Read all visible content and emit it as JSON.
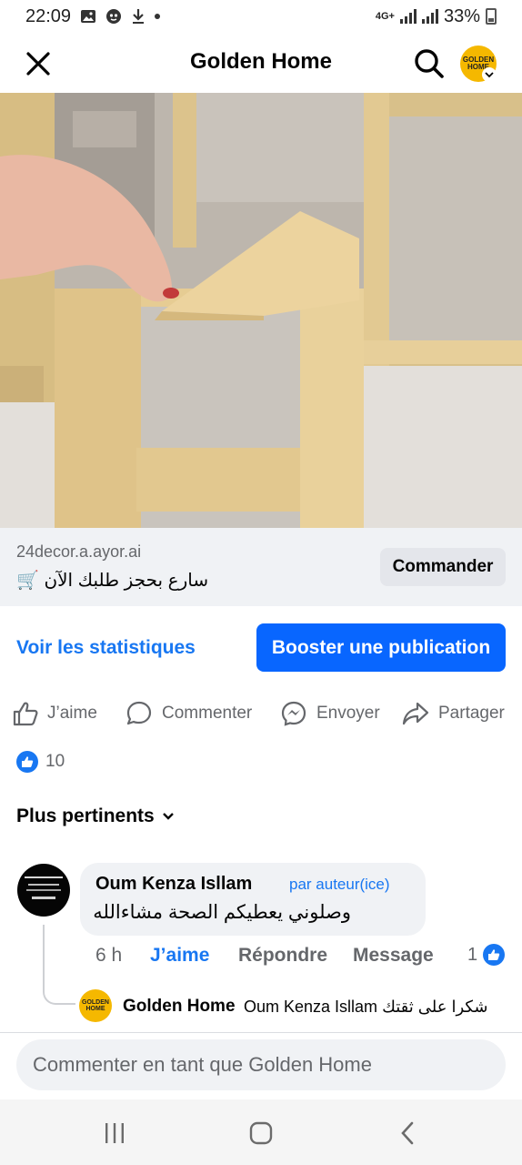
{
  "status_bar": {
    "time": "22:09",
    "network": "4G+",
    "battery": "33%"
  },
  "header": {
    "title": "Golden Home",
    "icons": [
      "close-icon",
      "search-icon",
      "page-avatar",
      "chevron-down-icon"
    ]
  },
  "page_logo": {
    "line1": "GOLDEN",
    "line2": "HOME"
  },
  "link_preview": {
    "domain": "24decor.a.ayor.ai",
    "title": "سارع بحجز طلبك الآن 🛒",
    "cta_label": "Commander",
    "background": "#f0f2f5"
  },
  "stats": {
    "link_label": "Voir les statistiques",
    "boost_label": "Booster une publication",
    "boost_color": "#0866ff",
    "link_color": "#1877f2"
  },
  "actions": {
    "like": "J’aime",
    "comment": "Commenter",
    "send": "Envoyer",
    "share": "Partager"
  },
  "reactions": {
    "count": "10",
    "icon": "like-icon"
  },
  "sort": {
    "label": "Plus pertinents"
  },
  "comment": {
    "author": "Oum Kenza Isllam",
    "badge": "par auteur(ice)",
    "text": "وصلوني يعطيكم الصحة مشاءالله",
    "time": "6 h",
    "like_label": "J’aime",
    "reply_label": "Répondre",
    "message_label": "Message",
    "like_count": "1"
  },
  "reply": {
    "author": "Golden Home",
    "text": "Oum Kenza Isllam شكرا على ثقتك"
  },
  "composer": {
    "placeholder": "Commenter en tant que Golden Home"
  },
  "nav": {
    "icons": [
      "recents-icon",
      "home-icon",
      "back-icon"
    ]
  }
}
